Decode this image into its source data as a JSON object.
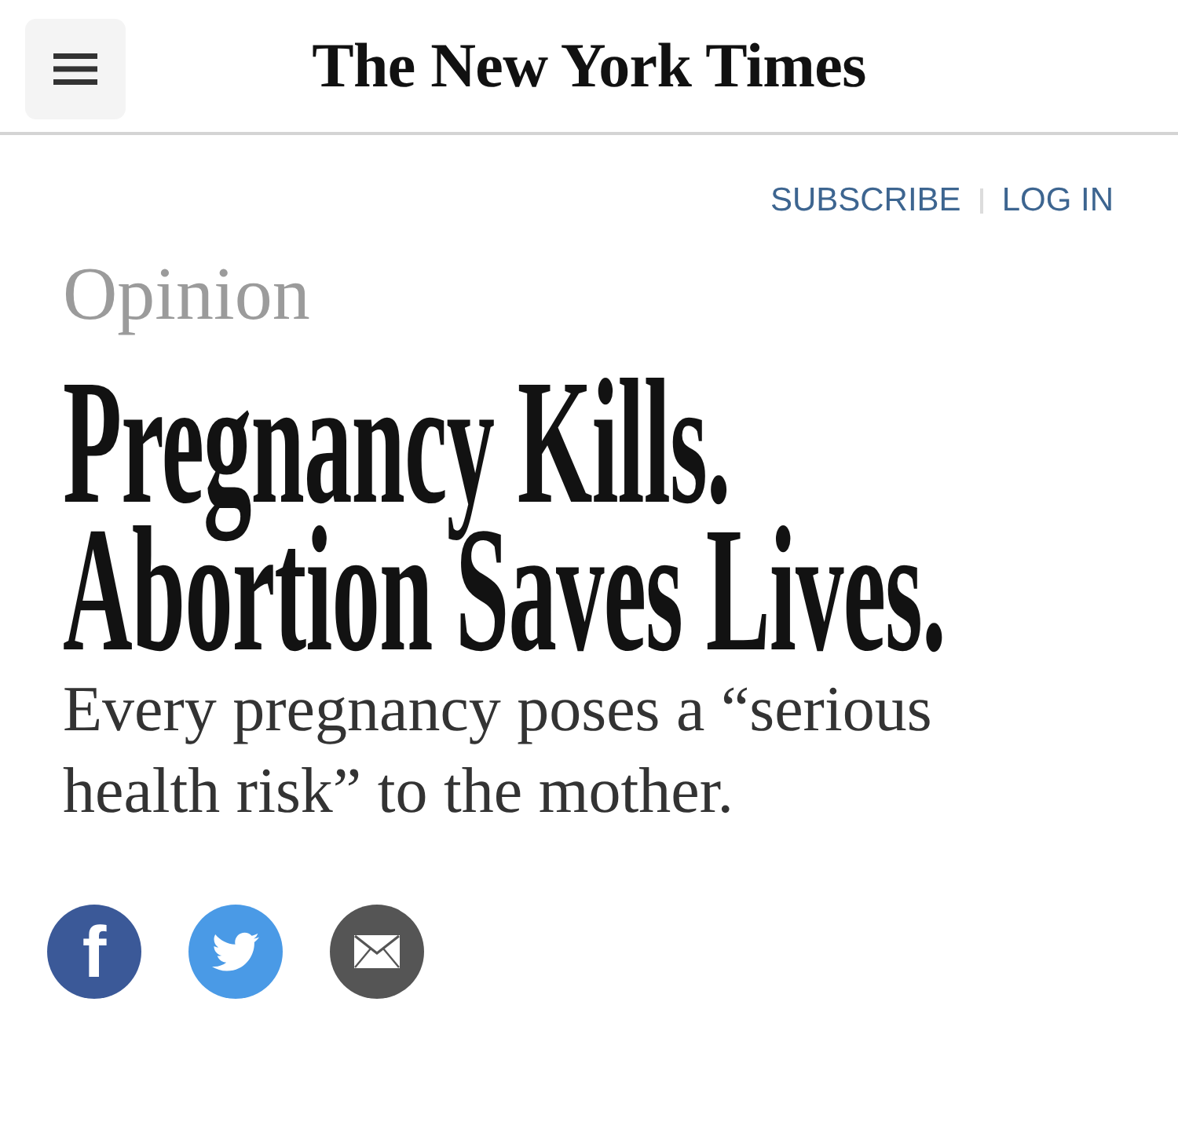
{
  "header": {
    "logo": "The New York Times"
  },
  "account_links": [
    {
      "label": "SUBSCRIBE"
    },
    {
      "label": "LOG IN"
    }
  ],
  "article": {
    "section": "Opinion",
    "headline": "Pregnancy Kills. Abortion Saves Lives.",
    "summary": "Every pregnancy poses a “serious health risk” to the mother."
  },
  "share_buttons": [
    {
      "kind": "facebook",
      "color": "#3b5998",
      "glyph": "f"
    },
    {
      "kind": "twitter",
      "color": "#4a9ae6"
    },
    {
      "kind": "email",
      "color": "#555555"
    }
  ]
}
